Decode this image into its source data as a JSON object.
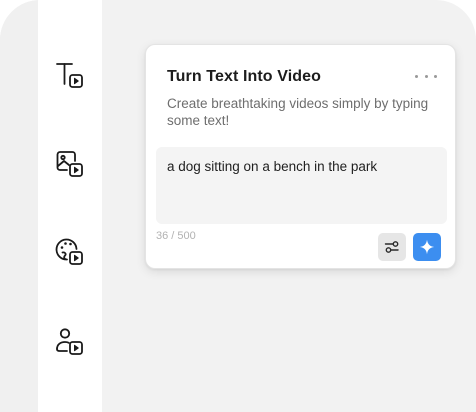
{
  "sidebar": {
    "items": [
      {
        "icon": "text-to-video-icon"
      },
      {
        "icon": "image-to-video-icon"
      },
      {
        "icon": "palette-to-video-icon"
      },
      {
        "icon": "avatar-to-video-icon"
      }
    ]
  },
  "card": {
    "title": "Turn Text Into Video",
    "subtitle": "Create breathtaking videos simply by typing some text!",
    "prompt_value": "a dog sitting on a bench in the park",
    "char_count": "36 / 500",
    "more_icon": "more-horizontal-icon",
    "settings_icon": "sliders-icon",
    "generate_icon": "sparkle-icon"
  },
  "colors": {
    "accent": "#3c8ef0",
    "background": "#f2f2f2",
    "rail": "#ffffff",
    "text": "#1c1c1c",
    "muted": "#6e6e6e"
  }
}
